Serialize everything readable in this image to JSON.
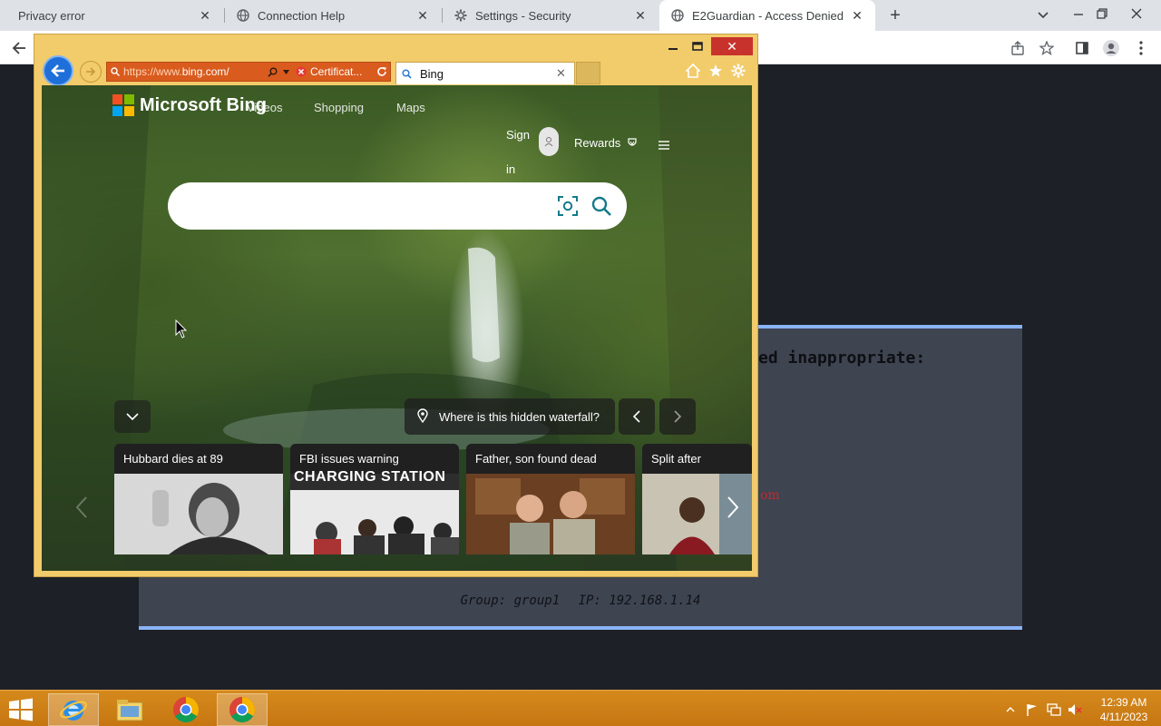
{
  "chrome": {
    "tabs": [
      {
        "title": "Privacy error",
        "icon": "privacy-warning-icon"
      },
      {
        "title": "Connection Help",
        "icon": "globe-icon"
      },
      {
        "title": "Settings - Security",
        "icon": "gear-icon"
      },
      {
        "title": "E2Guardian - Access Denied",
        "icon": "globe-icon",
        "active": true
      }
    ],
    "new_tab_label": "+"
  },
  "e2guardian": {
    "heading_fragment": "ed inappropriate:",
    "red_fragment": "om",
    "group_label": "Group: group1",
    "ip_label": "IP: 192.168.1.14"
  },
  "ie": {
    "close_label": "✕",
    "address": {
      "prefix": "https://www.",
      "host": "bing.com/",
      "cert_label": "Certificat..."
    },
    "tab_title": "Bing"
  },
  "bing": {
    "logo_text": "Microsoft Bing",
    "nav": [
      "Videos",
      "Shopping",
      "Maps"
    ],
    "sign_in": "Sign in",
    "rewards": "Rewards",
    "search_placeholder": "",
    "image_info": "Where is this hidden waterfall?",
    "news": [
      {
        "title": "Hubbard dies at 89"
      },
      {
        "title": "FBI issues warning",
        "overlay": "CHARGING STATION"
      },
      {
        "title": "Father, son found dead"
      },
      {
        "title": "Split after"
      }
    ]
  },
  "taskbar": {
    "time": "12:39 AM",
    "date": "4/11/2023"
  },
  "colors": {
    "ie_frame": "#f2cb6b",
    "ie_address": "#d95b1d",
    "taskbar": "#d58a1c",
    "e2_panel": "#3f4451",
    "e2_border": "#8ab4f8"
  }
}
